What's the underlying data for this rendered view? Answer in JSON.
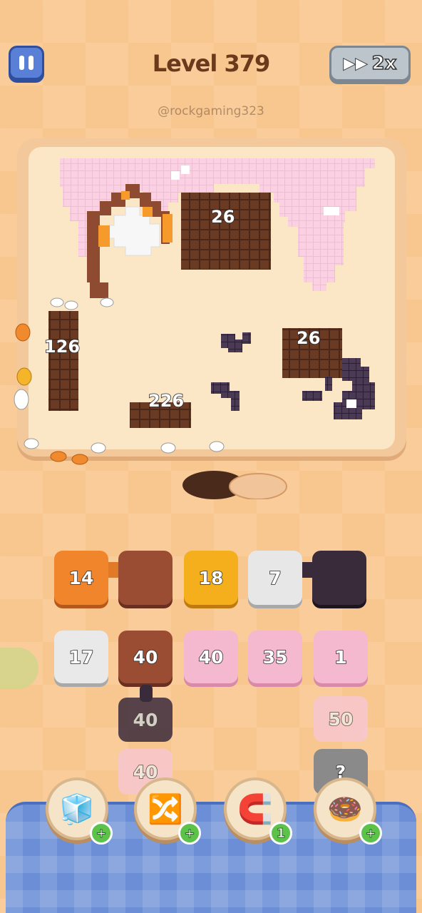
{
  "header": {
    "level_title": "Level 379",
    "speed_label": "2x",
    "watermark": "@rockgaming323"
  },
  "board": {
    "target_labels": [
      "26",
      "126",
      "26",
      "226"
    ]
  },
  "queue_row": [
    {
      "count": "14",
      "color": "#f0852b"
    },
    {
      "count": "",
      "color": "#9b4d33"
    },
    {
      "count": "18",
      "color": "#f5ae1c"
    },
    {
      "count": "7",
      "color": "#e7e7e7"
    },
    {
      "count": "",
      "color": "#3a2b3a"
    }
  ],
  "stack_row": [
    {
      "count": "17",
      "color": "#e9e9e9"
    },
    {
      "count": "40",
      "color": "#9b4d33"
    },
    {
      "count": "40",
      "color": "#f4b8cf"
    },
    {
      "count": "35",
      "color": "#f4b8cf"
    },
    {
      "count": "1",
      "color": "#f4b8cf"
    }
  ],
  "hidden_blocks": {
    "col2_mid": "40",
    "col2_low": "40",
    "col5_mid": "50",
    "col5_low": "?"
  },
  "boosters": [
    {
      "icon": "add-block-icon",
      "badge": "+"
    },
    {
      "icon": "swap-icon",
      "badge": "+"
    },
    {
      "icon": "magnet-icon",
      "badge": "1"
    },
    {
      "icon": "donut-icon",
      "badge": "+"
    }
  ]
}
